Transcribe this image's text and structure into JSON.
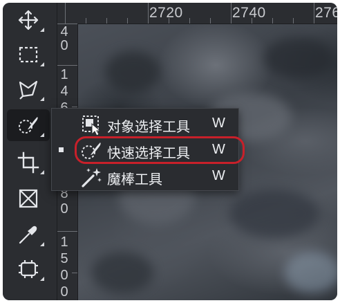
{
  "ruler": {
    "top_labels": [
      "2720",
      "2740",
      "276"
    ],
    "left_groups": [
      [
        "4",
        "0"
      ],
      [
        "1",
        "4",
        "6"
      ],
      [
        "8",
        "0"
      ],
      [
        "1",
        "5",
        "0",
        "0"
      ]
    ]
  },
  "toolbar": {
    "tools": [
      {
        "name": "move-tool",
        "icon": "move-icon",
        "active": false
      },
      {
        "name": "marquee-tool",
        "icon": "rectangular-marquee-icon",
        "active": false
      },
      {
        "name": "lasso-tool",
        "icon": "polygonal-lasso-icon",
        "active": false
      },
      {
        "name": "quick-selection-tool",
        "icon": "quick-selection-icon",
        "active": true
      },
      {
        "name": "crop-tool",
        "icon": "crop-icon",
        "active": false
      },
      {
        "name": "frame-tool",
        "icon": "frame-icon",
        "active": false
      },
      {
        "name": "eyedropper-tool",
        "icon": "eyedropper-icon",
        "active": false
      },
      {
        "name": "patch-tool",
        "icon": "patch-icon",
        "active": false
      }
    ]
  },
  "flyout": {
    "items": [
      {
        "label": "对象选择工具",
        "shortcut": "W",
        "icon": "object-selection-icon",
        "selected": false
      },
      {
        "label": "快速选择工具",
        "shortcut": "W",
        "icon": "quick-selection-icon",
        "selected": true
      },
      {
        "label": "魔棒工具",
        "shortcut": "W",
        "icon": "magic-wand-icon",
        "selected": false
      }
    ]
  },
  "colors": {
    "highlight": "#c8202a",
    "menu_bg": "#2a2c30",
    "toolbar_bg": "#2b2d31"
  }
}
